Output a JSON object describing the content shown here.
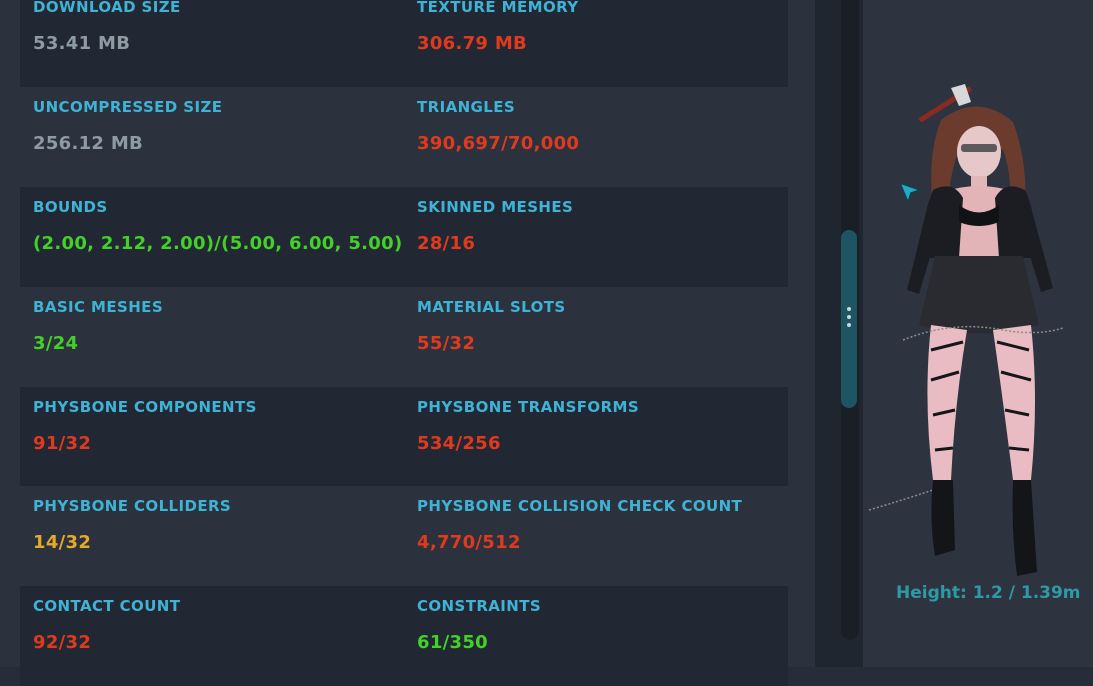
{
  "stats": [
    [
      {
        "label": "DOWNLOAD SIZE",
        "value": "53.41 MB",
        "color": "#8e9ba3"
      },
      {
        "label": "TEXTURE MEMORY",
        "value": "306.79 MB",
        "color": "#e03a1e"
      }
    ],
    [
      {
        "label": "UNCOMPRESSED SIZE",
        "value": "256.12 MB",
        "color": "#8e9ba3"
      },
      {
        "label": "TRIANGLES",
        "value": "390,697/70,000",
        "color": "#e03a1e"
      }
    ],
    [
      {
        "label": "BOUNDS",
        "value": "(2.00, 2.12, 2.00)/(5.00, 6.00, 5.00)",
        "color": "#43d128"
      },
      {
        "label": "SKINNED MESHES",
        "value": "28/16",
        "color": "#e03a1e"
      }
    ],
    [
      {
        "label": "BASIC MESHES",
        "value": "3/24",
        "color": "#43d128"
      },
      {
        "label": "MATERIAL SLOTS",
        "value": "55/32",
        "color": "#e03a1e"
      }
    ],
    [
      {
        "label": "PHYSBONE COMPONENTS",
        "value": "91/32",
        "color": "#e03a1e"
      },
      {
        "label": "PHYSBONE TRANSFORMS",
        "value": "534/256",
        "color": "#e03a1e"
      }
    ],
    [
      {
        "label": "PHYSBONE COLLIDERS",
        "value": "14/32",
        "color": "#e6a92a"
      },
      {
        "label": "PHYSBONE COLLISION CHECK COUNT",
        "value": "4,770/512",
        "color": "#e03a1e"
      }
    ],
    [
      {
        "label": "CONTACT COUNT",
        "value": "92/32",
        "color": "#e03a1e"
      },
      {
        "label": "CONSTRAINTS",
        "value": "61/350",
        "color": "#43d128"
      }
    ]
  ],
  "preview": {
    "height_text": "Height: 1.2 / 1.39m"
  },
  "icons": {
    "cursor": "cursor-pointer-icon",
    "scroll_grip": "drag-handle-icon"
  }
}
